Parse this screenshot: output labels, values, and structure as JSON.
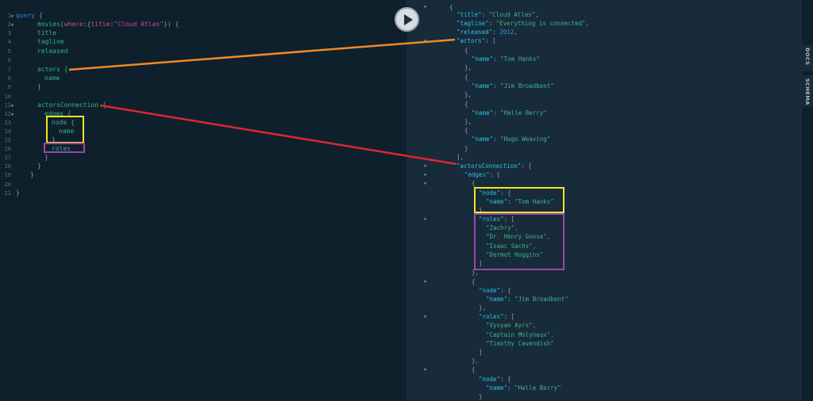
{
  "query_lines": [
    {
      "n": "1",
      "t": "query {"
    },
    {
      "n": "2",
      "t": "movies(where:{title:\"Cloud Atlas\"}) {"
    },
    {
      "n": "3",
      "t": "title"
    },
    {
      "n": "4",
      "t": "tagline"
    },
    {
      "n": "5",
      "t": "released"
    },
    {
      "n": "6",
      "t": ""
    },
    {
      "n": "7",
      "t": "actors {"
    },
    {
      "n": "8",
      "t": "name"
    },
    {
      "n": "9",
      "t": "}"
    },
    {
      "n": "10",
      "t": ""
    },
    {
      "n": "11",
      "t": "actorsConnection {"
    },
    {
      "n": "12",
      "t": "edges {"
    },
    {
      "n": "13",
      "t": "node {"
    },
    {
      "n": "14",
      "t": "name"
    },
    {
      "n": "15",
      "t": "}"
    },
    {
      "n": "16",
      "t": "roles"
    },
    {
      "n": "17",
      "t": "}"
    },
    {
      "n": "18",
      "t": "}"
    },
    {
      "n": "19",
      "t": "}"
    },
    {
      "n": "20",
      "t": ""
    },
    {
      "n": "21",
      "t": "}"
    }
  ],
  "query": {
    "keyword": "query",
    "field": "movies",
    "arg_name": "where",
    "arg_key": "title",
    "arg_value": "\"Cloud Atlas\""
  },
  "result": {
    "title_key": "\"title\"",
    "title_val": "\"Cloud Atlas\"",
    "tagline_key": "\"tagline\"",
    "tagline_val": "\"Everything is connected\"",
    "released_key": "\"released\"",
    "released_val": "2012",
    "actors_key": "\"actors\"",
    "name_key": "\"name\"",
    "actors": [
      "\"Tom Hanks\"",
      "\"Jim Broadbent\"",
      "\"Halle Berry\"",
      "\"Hugo Weaving\""
    ],
    "connection_key": "\"actorsConnection\"",
    "edges_key": "\"edges\"",
    "node_key": "\"node\"",
    "roles_key": "\"roles\"",
    "edge1_name": "\"Tom Hanks\"",
    "edge1_roles": [
      "\"Zachry\",",
      "\"Dr. Henry Goose\",",
      "\"Isaac Sachs\",",
      "\"Dermot Hoggins\""
    ],
    "edge2_name": "\"Jim Broadbent\"",
    "edge2_roles": [
      "\"Vyvyan Ayrs\",",
      "\"Captain Molyneux\",",
      "\"Timothy Cavendish\""
    ],
    "edge3_name": "\"Halle Berry\""
  },
  "sidebar": {
    "docs_label": "DOCS",
    "schema_label": "SCHEMA"
  },
  "colors": {
    "arrow_orange": "#f08a24",
    "arrow_red": "#e0262b",
    "box_yellow": "#f2e51d",
    "box_purple": "#a044b0"
  },
  "icons": {
    "run": "play-icon"
  }
}
